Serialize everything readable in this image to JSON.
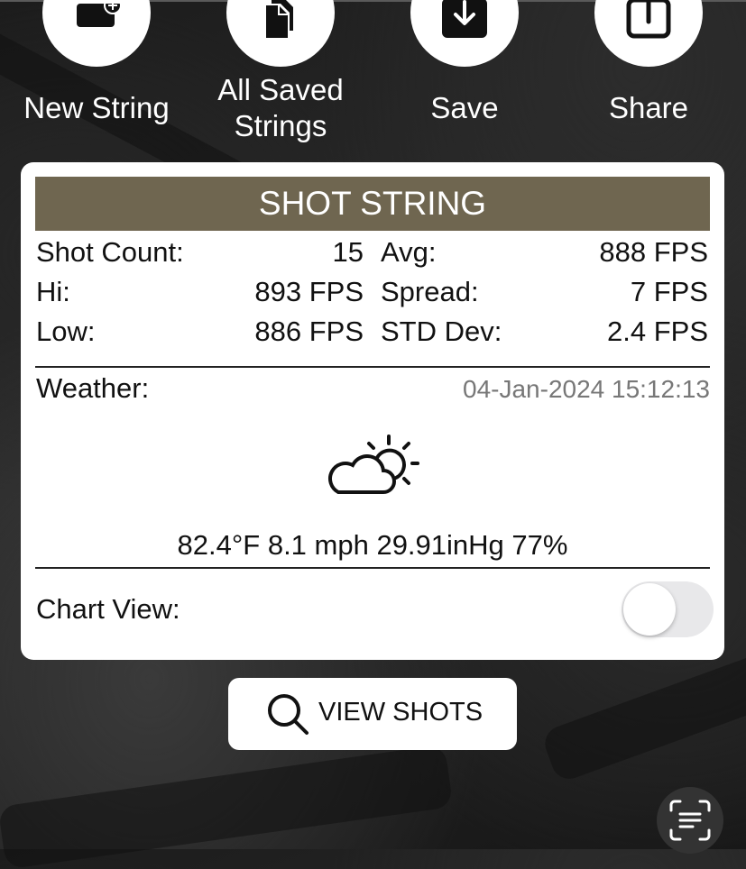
{
  "actions": {
    "new_string": "New String",
    "all_saved_line1": "All Saved",
    "all_saved_line2": "Strings",
    "save": "Save",
    "share": "Share"
  },
  "card": {
    "title": "SHOT STRING",
    "stats": {
      "shot_count_label": "Shot Count:",
      "shot_count_value": "15",
      "avg_label": "Avg:",
      "avg_value": "888 FPS",
      "hi_label": "Hi:",
      "hi_value": "893 FPS",
      "spread_label": "Spread:",
      "spread_value": "7 FPS",
      "low_label": "Low:",
      "low_value": "886 FPS",
      "std_label": "STD Dev:",
      "std_value": "2.4 FPS"
    },
    "weather": {
      "label": "Weather:",
      "timestamp": "04-Jan-2024 15:12:13",
      "icon": "partly-sunny-icon",
      "values": "82.4°F 8.1 mph 29.91inHg 77%"
    },
    "chart_view": {
      "label": "Chart View:",
      "enabled": false
    }
  },
  "view_shots": {
    "label": "VIEW SHOTS"
  },
  "colors": {
    "header_bg": "#6f6650",
    "card_bg": "#ffffff",
    "timestamp": "#777777"
  }
}
